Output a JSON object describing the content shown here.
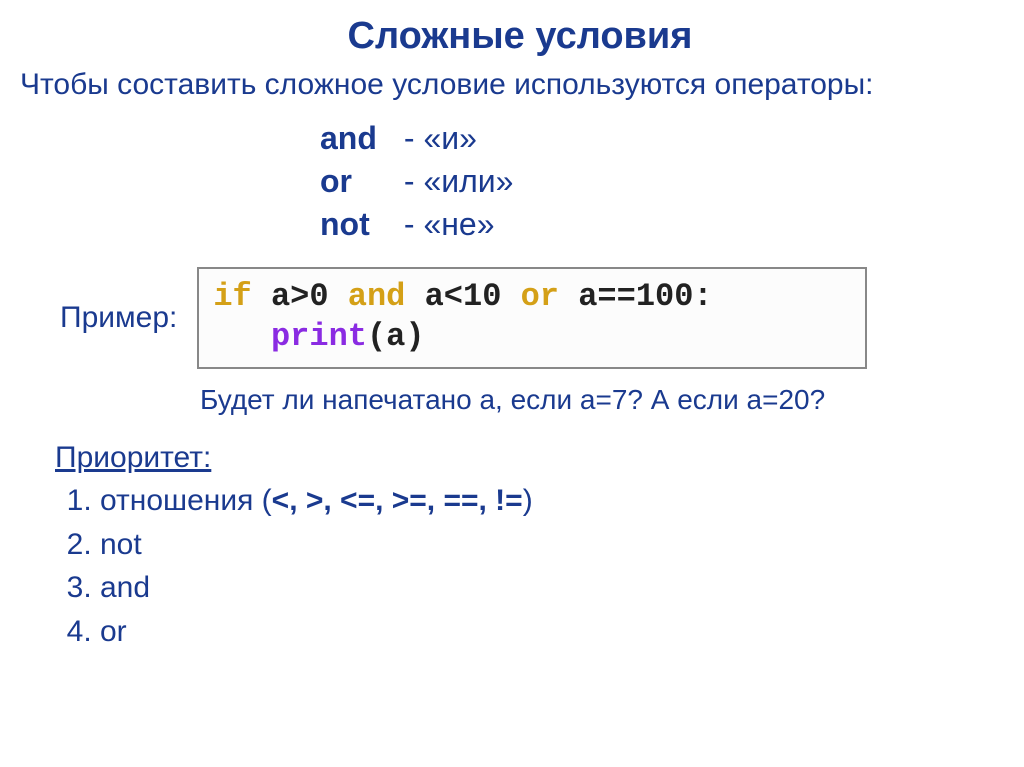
{
  "title": "Сложные условия",
  "intro": "Чтобы составить сложное условие используются операторы:",
  "operators": [
    {
      "kw": "and",
      "desc": " - «и»"
    },
    {
      "kw": "or",
      "desc": "   - «или»"
    },
    {
      "kw": "not",
      "desc": " - «не»"
    }
  ],
  "example_label": "Пример:",
  "code": {
    "line1": {
      "kw1": "if ",
      "s1": "a>0 ",
      "kw2": "and ",
      "s2": "a<10 ",
      "kw3": "or ",
      "s3": "a==100:"
    },
    "line2": {
      "indent": "   ",
      "fn": "print",
      "args": "(a)"
    }
  },
  "question": "Будет ли напечатано а, если а=7? А если а=20?",
  "priority": {
    "heading": "Приоритет:",
    "items": [
      {
        "prefix": "отношения (",
        "bold": "<, >, <=, >=, ==, !=",
        "suffix": ")"
      },
      {
        "prefix": "not",
        "bold": "",
        "suffix": ""
      },
      {
        "prefix": "and",
        "bold": "",
        "suffix": ""
      },
      {
        "prefix": "or",
        "bold": "",
        "suffix": ""
      }
    ]
  }
}
